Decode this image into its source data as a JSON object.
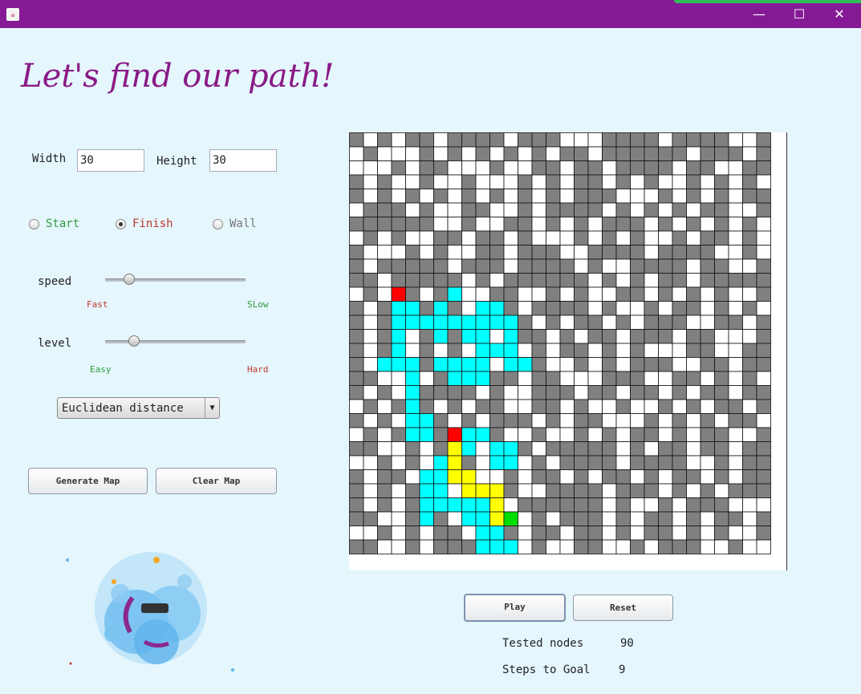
{
  "window": {
    "title": "",
    "minimize": "—",
    "maximize": "☐",
    "close": "✕"
  },
  "header": {
    "title": "Let's find our path!"
  },
  "size": {
    "width_label": "Width",
    "width_value": "30",
    "height_label": "Height",
    "height_value": "30"
  },
  "mode": [
    {
      "label": "Start",
      "selected": false,
      "color": "#2e9b3c"
    },
    {
      "label": "Finish",
      "selected": true,
      "color": "#c0392b"
    },
    {
      "label": "Wall",
      "selected": false,
      "color": "#777777"
    }
  ],
  "speed": {
    "label": "speed",
    "min_label": "Fast",
    "max_label": "SLow",
    "value": 0.14
  },
  "level": {
    "label": "level",
    "min_label": "Easy",
    "max_label": "Hard",
    "value": 0.18
  },
  "heuristic": {
    "selected": "Euclidean distance"
  },
  "actions": {
    "generate": "Generate Map",
    "clear": "Clear Map",
    "play": "Play",
    "reset": "Reset"
  },
  "stats": {
    "tested_label": "Tested nodes",
    "tested_value": "90",
    "steps_label": "Steps to Goal",
    "steps_value": "9"
  },
  "colors": {
    "wall": "#808080",
    "empty": "#ffffff",
    "visited": "#00ffff",
    "path": "#ffff00",
    "start": "#ff0000",
    "goal": "#00dd00",
    "accent": "#851b94"
  },
  "grid": {
    "rows": 30,
    "cols": 30,
    "cells": [
      "#.#.##.####.###...####.####..#",
      ".#...#.#.#.#.#.##.######.###.#",
      "...#.##...#..##.##.####.##..##",
      "#.#..#..#...#.#.##.#.#..#.#.#.",
      "#.#.#.#.#.#.#.#.###...#.#.#.##",
      ".###.#..##..#.####.#.#.#.##..#",
      "######..#..##.#.#.###.#.#.#.#.",
      ".#.#..##.##.#...#.#.#..#.##.#.",
      "#...#.#..##.###..####.####..#.",
      "#.#####.###.####.#..####.##..#",
      "##.#####.#.######.#.#.##.#####",
      ".#..#.##..##..#.#..##.#.#.#..#",
      "#.##.###.###.####.#..#.##.#.#.",
      "#.##.#.#.####.#.##.#.###..##.#",
      "#.#..###.#.###.#.##.###.##...#",
      "#.#..#.#..##.#.##.#.#...##..##",
      "#...######.#.#..#.#.###..##.##",
      "##..#.##.###.##...###..##.#.#.",
      "#.#.#####.#..###.##.##.#.##.##",
      ".#.#.#.#.##..##.#..#..#.#.##.#",
      "#.#.#.#.#.###.#.##...#.#.#.##.",
      ".#.#.######..#..#.#.##.#.##..#",
      "##..#.##..#.#.#####.#.##.##.##",
      "..#.#.#.#.#..#.####.####..#.##",
      "#.##.#.#...#.##.#.##.#.##.#.##",
      "#.#.#.#..#.#..####.###.#.#.###",
      "#.#.#######.######.#..#.###...",
      "##..#.#.#.##.#.###.#.##.#.##.#",
      "..#.#.##...#.##.##.#.##.#.#..#",
      "##..#.####...#..##..#.###..#.."
    ],
    "visited": [
      [
        11,
        7
      ],
      [
        12,
        3
      ],
      [
        12,
        4
      ],
      [
        12,
        6
      ],
      [
        12,
        9
      ],
      [
        12,
        10
      ],
      [
        13,
        3
      ],
      [
        13,
        4
      ],
      [
        13,
        5
      ],
      [
        13,
        6
      ],
      [
        13,
        7
      ],
      [
        13,
        8
      ],
      [
        13,
        9
      ],
      [
        13,
        10
      ],
      [
        13,
        11
      ],
      [
        14,
        3
      ],
      [
        14,
        6
      ],
      [
        14,
        8
      ],
      [
        14,
        9
      ],
      [
        14,
        11
      ],
      [
        15,
        3
      ],
      [
        15,
        9
      ],
      [
        15,
        10
      ],
      [
        15,
        11
      ],
      [
        16,
        2
      ],
      [
        16,
        3
      ],
      [
        16,
        4
      ],
      [
        16,
        6
      ],
      [
        16,
        7
      ],
      [
        16,
        8
      ],
      [
        16,
        9
      ],
      [
        16,
        11
      ],
      [
        16,
        12
      ],
      [
        17,
        4
      ],
      [
        17,
        7
      ],
      [
        17,
        8
      ],
      [
        17,
        9
      ],
      [
        18,
        4
      ],
      [
        19,
        4
      ],
      [
        20,
        4
      ],
      [
        20,
        5
      ],
      [
        21,
        4
      ],
      [
        21,
        5
      ],
      [
        21,
        8
      ],
      [
        21,
        9
      ],
      [
        22,
        10
      ],
      [
        22,
        11
      ],
      [
        23,
        6
      ],
      [
        23,
        10
      ],
      [
        23,
        11
      ],
      [
        24,
        5
      ],
      [
        24,
        6
      ],
      [
        25,
        5
      ],
      [
        25,
        6
      ],
      [
        25,
        9
      ],
      [
        26,
        5
      ],
      [
        26,
        6
      ],
      [
        26,
        7
      ],
      [
        26,
        8
      ],
      [
        26,
        9
      ],
      [
        27,
        5
      ],
      [
        27,
        8
      ],
      [
        27,
        9
      ],
      [
        27,
        10
      ],
      [
        28,
        9
      ],
      [
        28,
        10
      ],
      [
        29,
        9
      ],
      [
        29,
        10
      ],
      [
        29,
        11
      ],
      [
        22,
        7
      ],
      [
        22,
        8
      ]
    ],
    "path": [
      [
        22,
        7
      ],
      [
        23,
        7
      ],
      [
        24,
        7
      ],
      [
        24,
        8
      ],
      [
        25,
        8
      ],
      [
        25,
        9
      ],
      [
        25,
        10
      ],
      [
        26,
        10
      ],
      [
        27,
        10
      ]
    ],
    "start": [
      11,
      3
    ],
    "goal": [
      27,
      11
    ],
    "marker": [
      21,
      7
    ]
  }
}
